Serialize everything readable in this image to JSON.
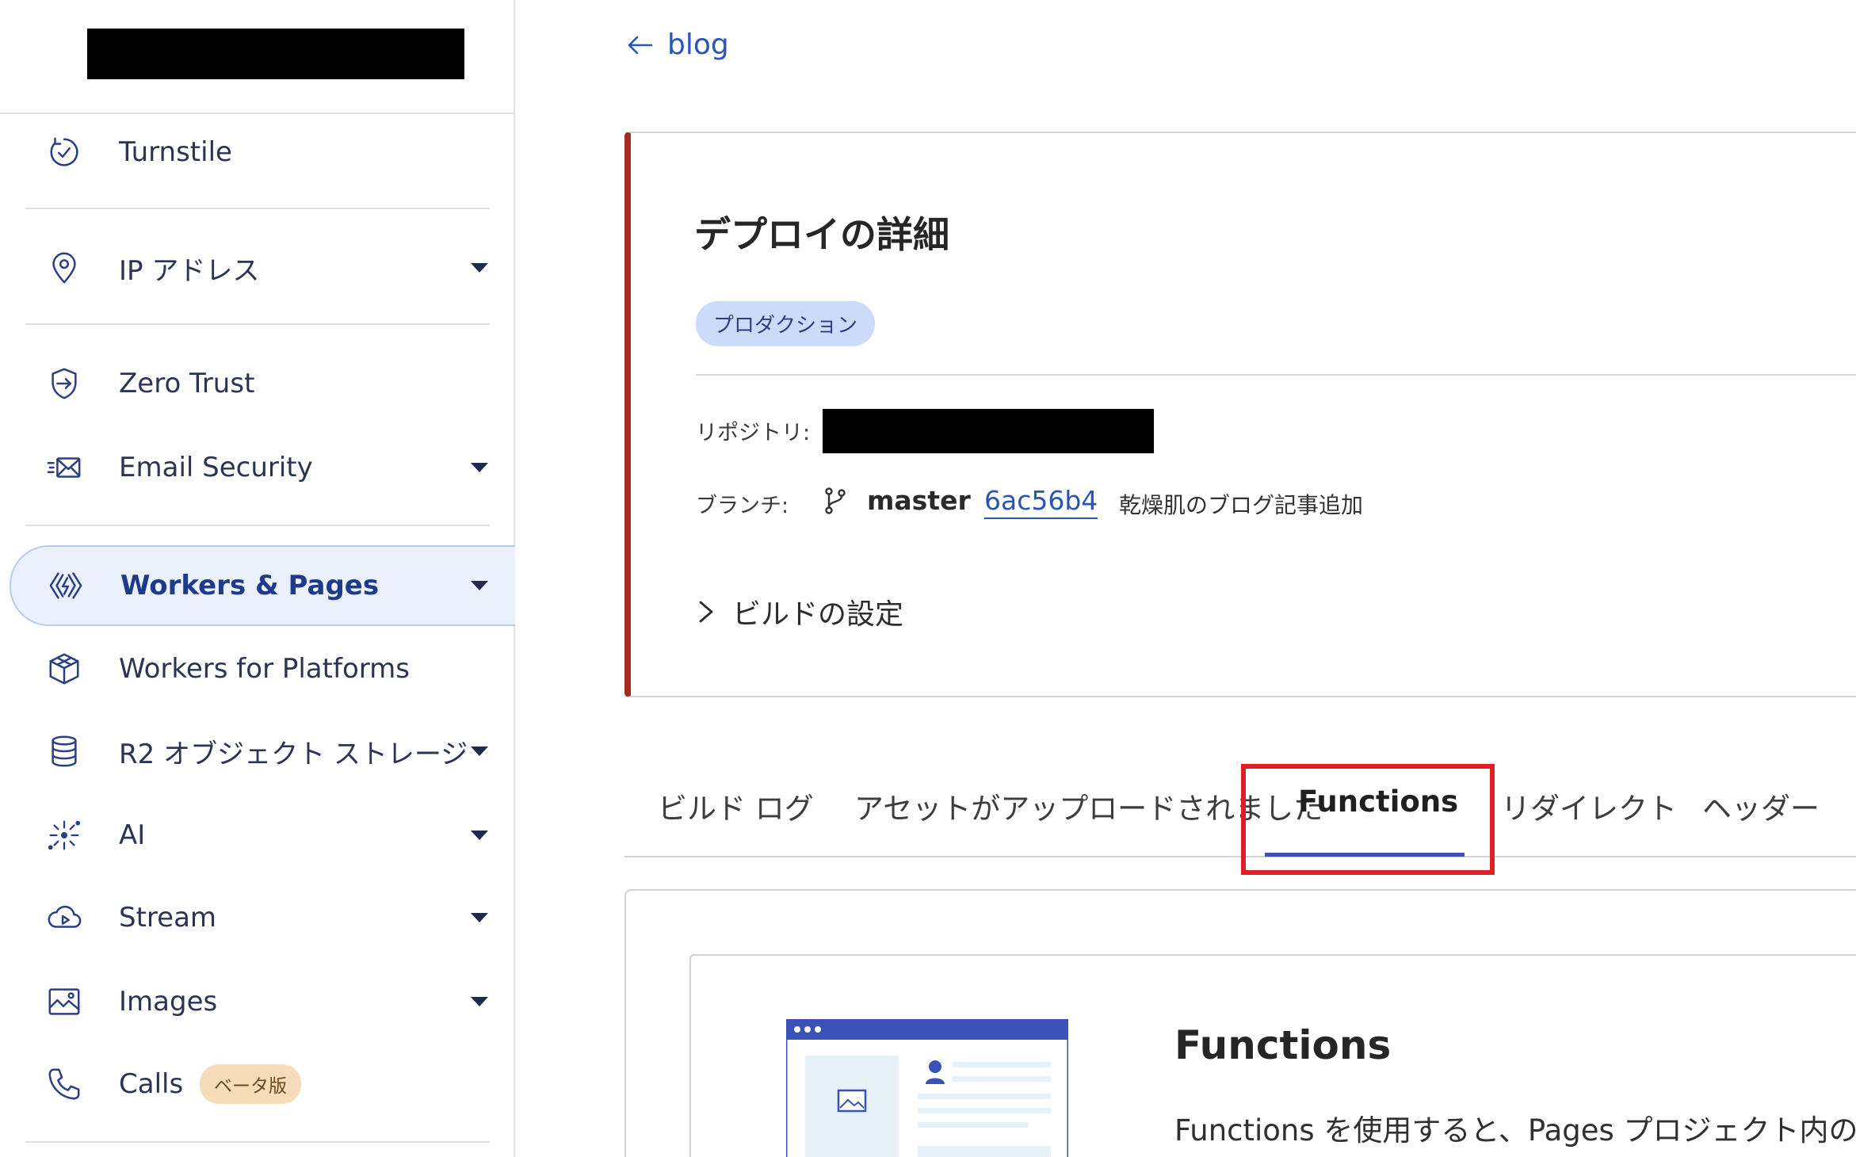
{
  "sidebar": {
    "items": [
      {
        "label": "Turnstile",
        "icon": "turnstile-icon",
        "has_caret": false
      },
      {
        "label": "IP アドレス",
        "icon": "location-pin-icon",
        "has_caret": true
      },
      {
        "label": "Zero Trust",
        "icon": "zero-trust-icon",
        "has_caret": false
      },
      {
        "label": "Email Security",
        "icon": "email-icon",
        "has_caret": true
      },
      {
        "label": "Workers & Pages",
        "icon": "workers-icon",
        "has_caret": true,
        "active": true
      },
      {
        "label": "Workers for Platforms",
        "icon": "cube-icon",
        "has_caret": false
      },
      {
        "label": "R2 オブジェクト ストレージ",
        "icon": "database-icon",
        "has_caret": true
      },
      {
        "label": "AI",
        "icon": "sparkle-icon",
        "has_caret": true
      },
      {
        "label": "Stream",
        "icon": "cloud-play-icon",
        "has_caret": true
      },
      {
        "label": "Images",
        "icon": "image-icon",
        "has_caret": true
      },
      {
        "label": "Calls",
        "icon": "phone-icon",
        "has_caret": false,
        "badge": "ベータ版"
      }
    ]
  },
  "breadcrumb": {
    "back_label": "blog"
  },
  "deploy": {
    "title": "デプロイの詳細",
    "environment_badge": "プロダクション",
    "repo_label": "リポジトリ:",
    "branch_label": "ブランチ:",
    "branch_name": "master",
    "commit_hash": "6ac56b4",
    "commit_message": "乾燥肌のブログ記事追加",
    "build_settings_label": "ビルドの設定"
  },
  "tabs": [
    {
      "label": "ビルド ログ"
    },
    {
      "label": "アセットがアップロードされました"
    },
    {
      "label": "Functions",
      "active": true
    },
    {
      "label": "リダイレクト"
    },
    {
      "label": "ヘッダー"
    }
  ],
  "functions_panel": {
    "heading": "Functions",
    "description": "Functions を使用すると、Pages プロジェクト内の Work"
  },
  "colors": {
    "accent": "#3a52b8",
    "link": "#2a55b8",
    "production_border": "#a32b1f",
    "highlight": "#dd1f26",
    "active_bg": "#eaf0fc"
  }
}
